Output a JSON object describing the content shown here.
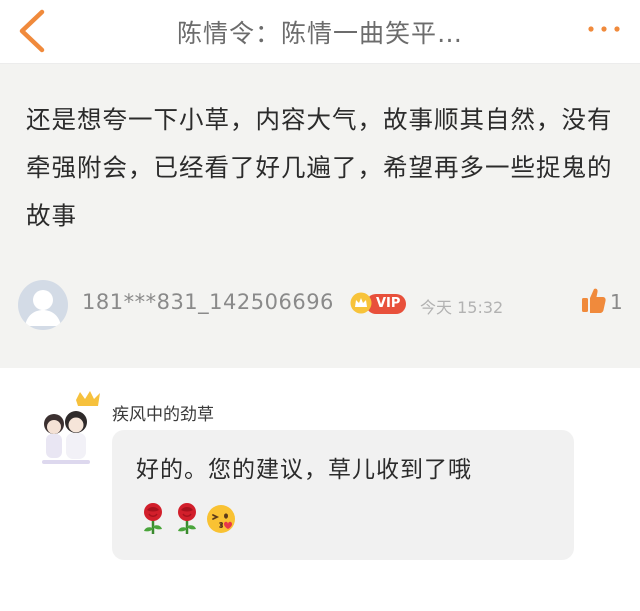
{
  "header": {
    "title": "陈情令：陈情一曲笑平…",
    "back_icon": "chevron-left-icon",
    "more_icon": "more-dots-icon",
    "accent_color": "#f08a3c"
  },
  "comment": {
    "text": "还是想夸一下小草，内容大气，故事顺其自然，没有牵强附会，已经看了好几遍了，希望再多一些捉鬼的故事",
    "username": "181***831_142506696",
    "vip_label": "VIP",
    "time": "今天 15:32",
    "like_count": "1",
    "avatar_icon": "default-avatar-icon",
    "like_icon": "thumbs-up-icon"
  },
  "reply": {
    "author": "疾风中的劲草",
    "text": "好的。您的建议，草儿收到了哦",
    "emojis": [
      "rose-icon",
      "rose-icon",
      "kissing-face-icon"
    ],
    "badge_icon": "crown-icon"
  }
}
